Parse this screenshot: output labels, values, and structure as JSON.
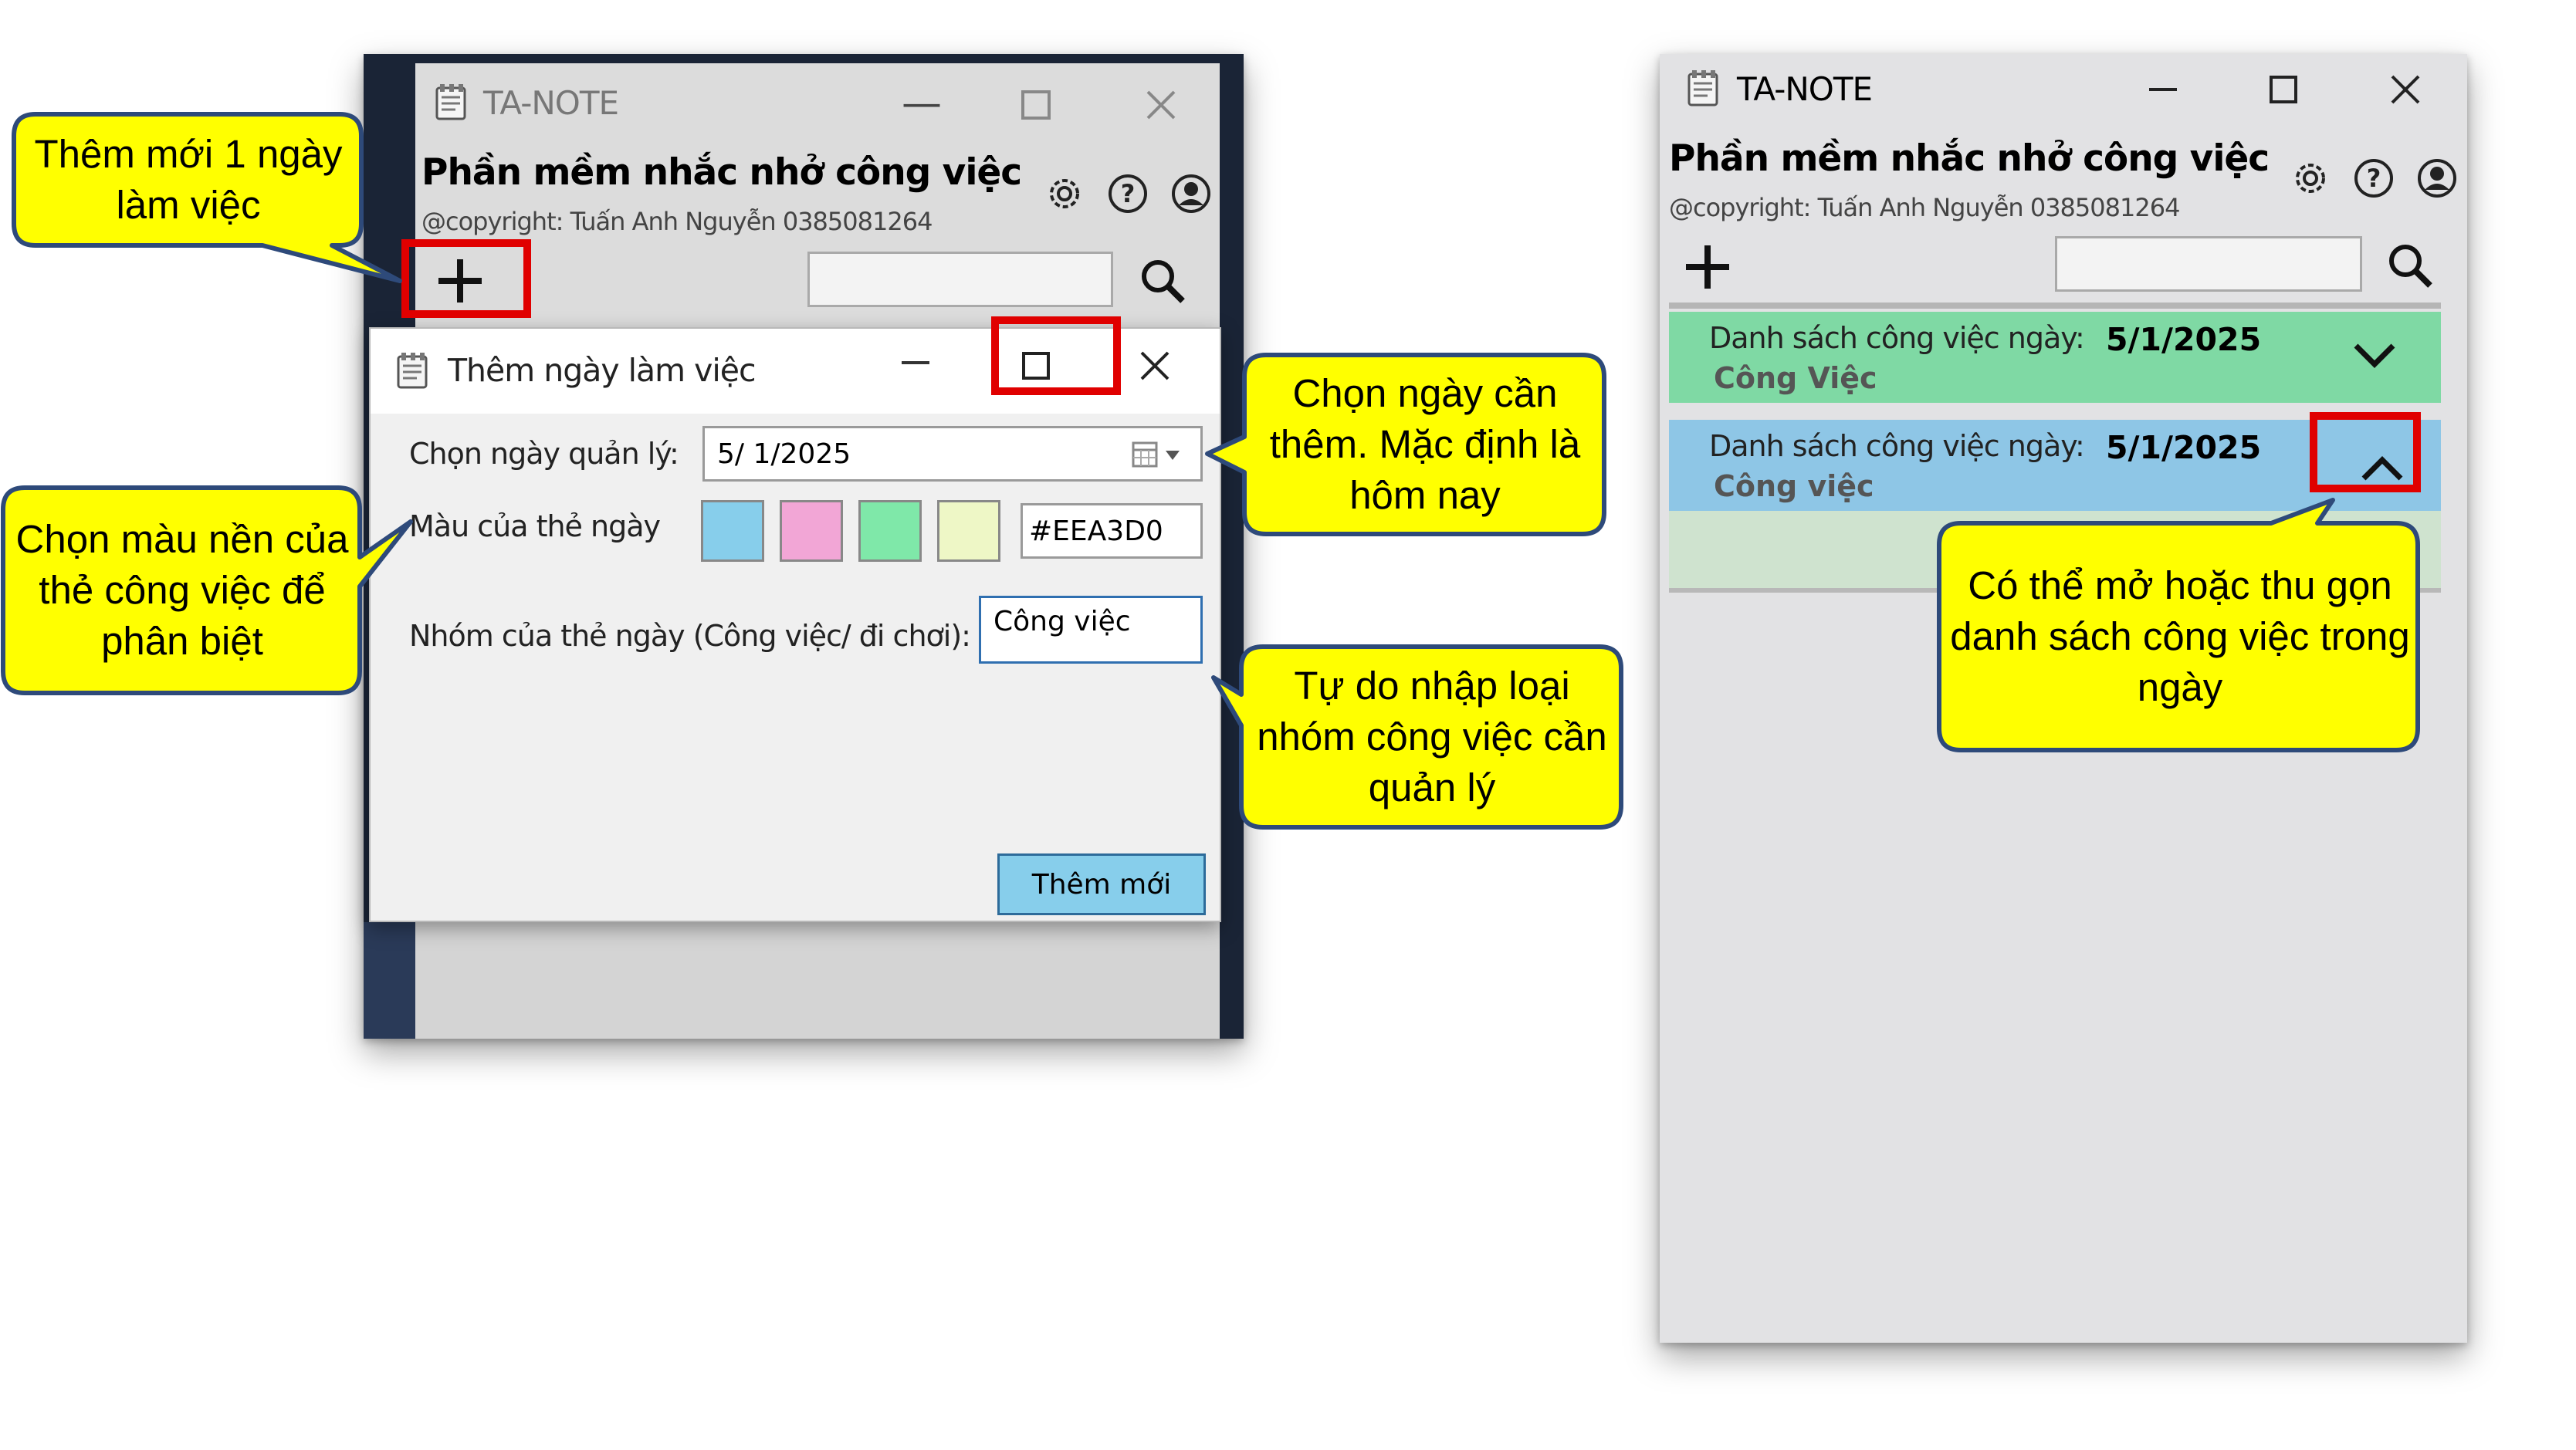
{
  "main_window": {
    "title": "TA-NOTE",
    "app_heading": "Phần mềm nhắc nhở công việc",
    "copyright": "@copyright: Tuấn Anh Nguyễn 0385081264",
    "icons": [
      "app-notepad-icon",
      "minimize-icon",
      "maximize-icon",
      "close-icon",
      "gear-icon",
      "help-icon",
      "user-icon",
      "plus-icon",
      "search-icon"
    ],
    "search_value": ""
  },
  "dialog": {
    "title": "Thêm ngày làm việc",
    "date_label": "Chọn ngày quản lý:",
    "date_value": "5/  1/2025",
    "color_label": "Màu của thẻ ngày",
    "swatches": [
      "#87ceeb",
      "#f2a6d6",
      "#7fe8a9",
      "#eef7c6"
    ],
    "color_value": "#EEA3D0",
    "group_label": "Nhóm của thẻ ngày (Công việc/ đi chơi):",
    "group_value": "Công việc",
    "add_button": "Thêm mới"
  },
  "right_window": {
    "title": "TA-NOTE",
    "app_heading": "Phần mềm nhắc nhở công việc",
    "copyright": "@copyright: Tuấn Anh Nguyễn 0385081264",
    "search_value": "",
    "cards": [
      {
        "label": "Danh sách công việc ngày:",
        "date": "5/1/2025",
        "group": "Công Việc",
        "color": "#7fd9a4",
        "state": "collapsed"
      },
      {
        "label": "Danh sách công việc ngày:",
        "date": "5/1/2025",
        "group": "Công việc",
        "color": "#8ec6e6",
        "state": "expanded"
      }
    ]
  },
  "callouts": {
    "add_day": "Thêm mới 1 ngày làm việc",
    "choose_color": "Chọn màu nền của thẻ công việc để phân biệt",
    "choose_date": "Chọn ngày cần thêm. Mặc định là hôm nay",
    "free_group": "Tự do nhập loại nhóm công việc cần quản lý",
    "toggle_list": "Có thể mở hoặc thu gọn danh sách  công việc trong ngày"
  },
  "colors": {
    "callout_fill": "#ffff00",
    "callout_stroke": "#2e4a7a",
    "highlight": "#e00000"
  }
}
